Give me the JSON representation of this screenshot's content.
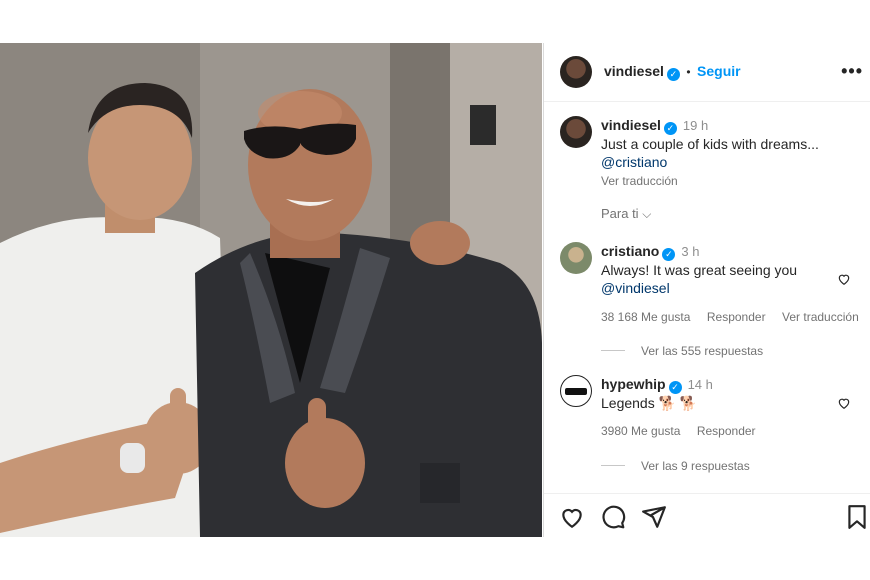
{
  "post_header": {
    "username": "vindiesel",
    "separator": "•",
    "follow_label": "Seguir",
    "more_icon": "more-dots-icon"
  },
  "caption": {
    "username": "vindiesel",
    "time": "19 h",
    "text": "Just a couple of kids with dreams...",
    "mention": "@cristiano",
    "translate_label": "Ver traducción"
  },
  "for_you_label": "Para ti",
  "comments": [
    {
      "username": "cristiano",
      "time": "3 h",
      "text": "Always! It was great seeing you",
      "mention": "@vindiesel",
      "likes": "38 168 Me gusta",
      "reply_label": "Responder",
      "translate_label": "Ver traducción",
      "view_replies": "Ver las 555 respuestas"
    },
    {
      "username": "hypewhip",
      "time": "14 h",
      "text": "Legends 🐕 🐕",
      "likes": "3980 Me gusta",
      "reply_label": "Responder",
      "view_replies": "Ver las 9 respuestas"
    }
  ],
  "colors": {
    "accent": "#0095f6",
    "link": "#00376b",
    "muted": "#737373"
  },
  "action_icons": [
    "heart-icon",
    "comment-icon",
    "share-icon",
    "bookmark-icon"
  ]
}
